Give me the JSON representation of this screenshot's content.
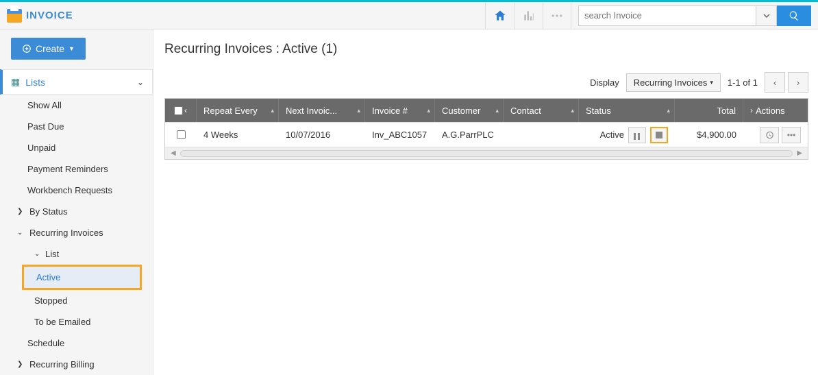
{
  "app": {
    "name": "INVOICE"
  },
  "header": {
    "search_placeholder": "search Invoice"
  },
  "sidebar": {
    "create_label": "Create",
    "lists_label": "Lists",
    "items": [
      {
        "label": "Show All"
      },
      {
        "label": "Past Due"
      },
      {
        "label": "Unpaid"
      },
      {
        "label": "Payment Reminders"
      },
      {
        "label": "Workbench Requests"
      }
    ],
    "by_status": "By Status",
    "recurring_invoices": "Recurring Invoices",
    "recurring_sub": {
      "list": "List",
      "active": "Active",
      "stopped": "Stopped",
      "to_be_emailed": "To be Emailed"
    },
    "schedule": "Schedule",
    "recurring_billing": "Recurring Billing"
  },
  "page": {
    "title": "Recurring Invoices : Active (1)",
    "display_label": "Display",
    "display_value": "Recurring Invoices",
    "pager": "1-1 of 1"
  },
  "table": {
    "headers": {
      "repeat": "Repeat Every",
      "next": "Next Invoic...",
      "invno": "Invoice #",
      "customer": "Customer",
      "contact": "Contact",
      "status": "Status",
      "total": "Total",
      "actions": "Actions"
    },
    "rows": [
      {
        "repeat": "4 Weeks",
        "next": "10/07/2016",
        "invno": "Inv_ABC1057",
        "customer": "A.G.ParrPLC",
        "contact": "",
        "status": "Active",
        "total": "$4,900.00"
      }
    ]
  }
}
